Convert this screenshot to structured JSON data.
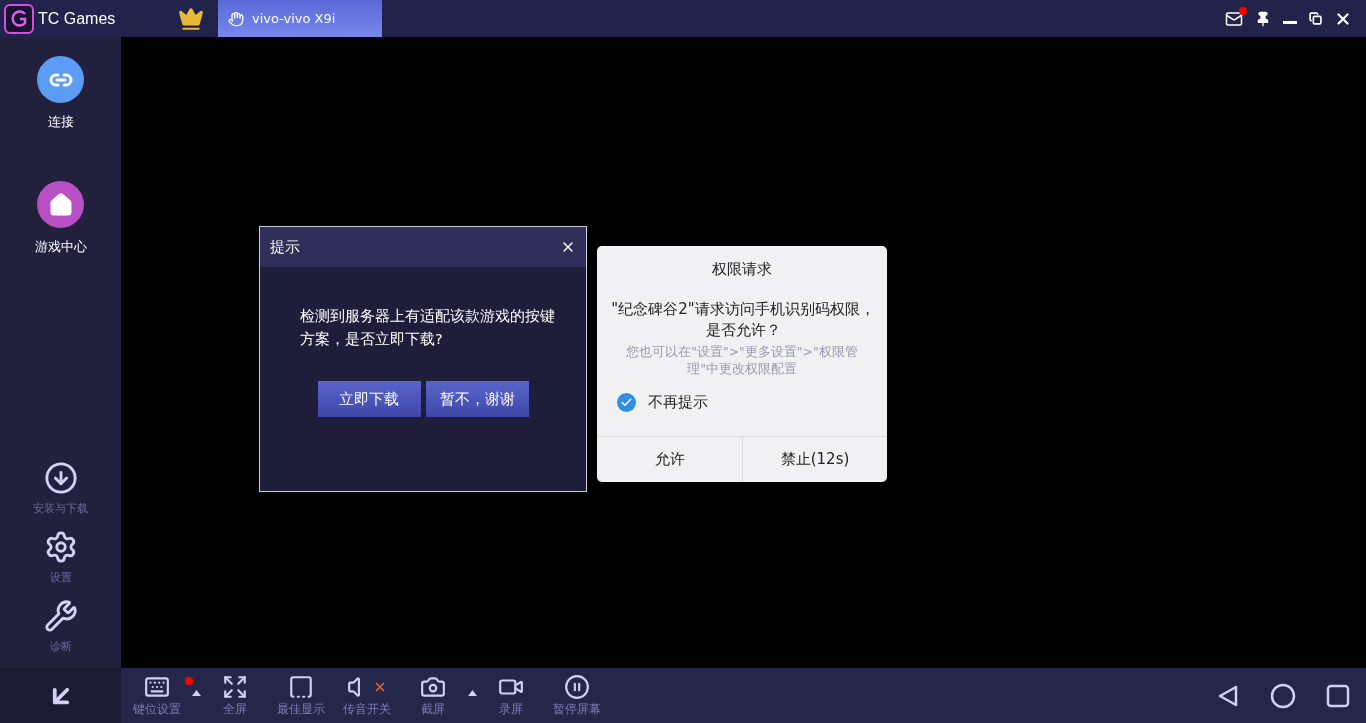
{
  "titlebar": {
    "logo_text": "TC Games",
    "device_tab": {
      "label": "vivo-vivo X9i",
      "selected": true
    },
    "controls": [
      {
        "kind": "mail",
        "unread": true
      },
      {
        "kind": "pin"
      },
      {
        "kind": "minimize"
      },
      {
        "kind": "restore"
      },
      {
        "kind": "close"
      }
    ]
  },
  "sidebar": {
    "items": [
      {
        "kind": "primary",
        "label": "连接",
        "color": "#5b9cf6"
      },
      {
        "kind": "primary",
        "label": "游戏中心",
        "color": "#b84fc4"
      },
      {
        "kind": "tool",
        "label": "安装与下载"
      },
      {
        "kind": "tool",
        "label": "设置"
      },
      {
        "kind": "tool",
        "label": "诊断"
      }
    ]
  },
  "tip_dialog": {
    "title": "提示",
    "message": "检测到服务器上有适配该款游戏的按键方案，是否立即下载?",
    "buttons": [
      "立即下载",
      "暂不，谢谢"
    ]
  },
  "permission_dialog": {
    "title": "权限请求",
    "message": "\"纪念碑谷2\"请求访问手机识别码权限，是否允许？",
    "hint": "您也可以在\"设置\">\"更多设置\">\"权限管理\"中更改权限配置",
    "checkbox": {
      "label": "不再提示",
      "checked": true
    },
    "buttons": [
      "允许",
      "禁止(12s)"
    ]
  },
  "toolbar": {
    "items": [
      {
        "label": "键位设置",
        "badge": true,
        "has_menu": true
      },
      {
        "label": "全屏",
        "badge": false,
        "has_menu": false
      },
      {
        "label": "最佳显示",
        "badge": false,
        "has_menu": false
      },
      {
        "label": "传音开关",
        "badge": false,
        "has_menu": false
      },
      {
        "label": "截屏",
        "badge": false,
        "has_menu": true
      },
      {
        "label": "录屏",
        "badge": false,
        "has_menu": false
      },
      {
        "label": "暂停屏幕",
        "badge": false,
        "has_menu": false
      }
    ]
  }
}
